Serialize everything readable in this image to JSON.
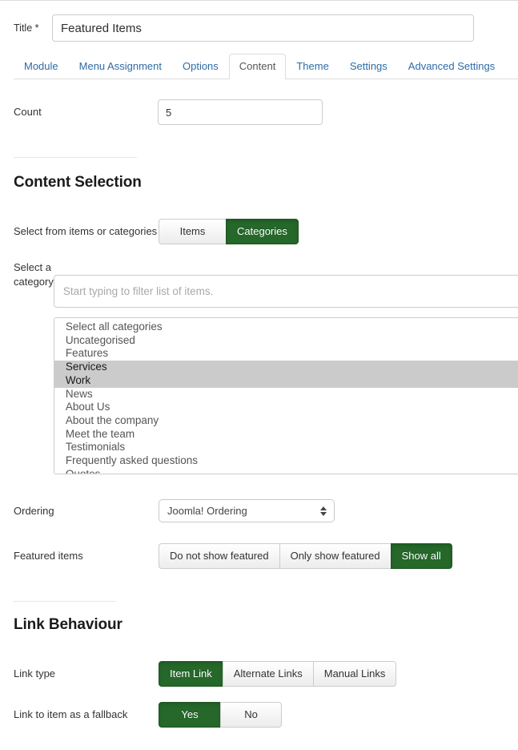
{
  "form": {
    "title_label": "Title *",
    "title_value": "Featured Items"
  },
  "tabs": [
    {
      "label": "Module",
      "active": false
    },
    {
      "label": "Menu Assignment",
      "active": false
    },
    {
      "label": "Options",
      "active": false
    },
    {
      "label": "Content",
      "active": true
    },
    {
      "label": "Theme",
      "active": false
    },
    {
      "label": "Settings",
      "active": false
    },
    {
      "label": "Advanced Settings",
      "active": false
    }
  ],
  "count": {
    "label": "Count",
    "value": "5"
  },
  "content_selection": {
    "heading": "Content Selection",
    "select_from": {
      "label": "Select from items or categories",
      "options": [
        "Items",
        "Categories"
      ],
      "selected": "Categories"
    },
    "select_category": {
      "label": "Select a category",
      "filter_placeholder": "Start typing to filter list of items.",
      "filter_value": "",
      "options": [
        "Select all categories",
        "Uncategorised",
        "Features",
        "Services",
        "Work",
        "News",
        "About Us",
        "About the company",
        "Meet the team",
        "Testimonials",
        "Frequently asked questions",
        "Quotes"
      ],
      "selected": [
        "Services",
        "Work"
      ]
    },
    "ordering": {
      "label": "Ordering",
      "value": "Joomla! Ordering"
    },
    "featured_items": {
      "label": "Featured items",
      "options": [
        "Do not show featured",
        "Only show featured",
        "Show all"
      ],
      "selected": "Show all"
    }
  },
  "link_behaviour": {
    "heading": "Link Behaviour",
    "link_type": {
      "label": "Link type",
      "options": [
        "Item Link",
        "Alternate Links",
        "Manual Links"
      ],
      "selected": "Item Link"
    },
    "fallback": {
      "label": "Link to item as a fallback",
      "options": [
        "Yes",
        "No"
      ],
      "selected": "Yes"
    }
  },
  "colors": {
    "accent_green": "#25682a",
    "link_blue": "#2f6ba5",
    "selection_gray": "#cbcbcb",
    "border_gray": "#cccccc"
  }
}
